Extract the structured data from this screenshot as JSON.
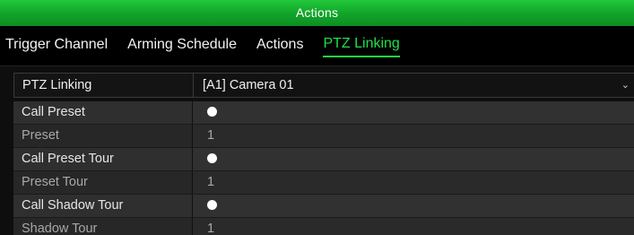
{
  "window": {
    "title": "Actions"
  },
  "tabs": [
    {
      "label": "Trigger Channel",
      "active": false
    },
    {
      "label": "Arming Schedule",
      "active": false
    },
    {
      "label": "Actions",
      "active": false
    },
    {
      "label": "PTZ Linking",
      "active": true
    }
  ],
  "form": {
    "ptz_linking": {
      "label": "PTZ Linking",
      "value": "[A1] Camera 01"
    },
    "rows": [
      {
        "label": "Call Preset",
        "type": "radio",
        "checked": true
      },
      {
        "label": "Preset",
        "value": "1"
      },
      {
        "label": "Call Preset Tour",
        "type": "radio",
        "checked": true
      },
      {
        "label": "Preset Tour",
        "value": "1"
      },
      {
        "label": "Call Shadow Tour",
        "type": "radio",
        "checked": true
      },
      {
        "label": "Shadow Tour",
        "value": "1"
      }
    ]
  },
  "colors": {
    "accent": "#20e04a",
    "title_bar": "#12a62a",
    "background": "#0e0e0e"
  }
}
